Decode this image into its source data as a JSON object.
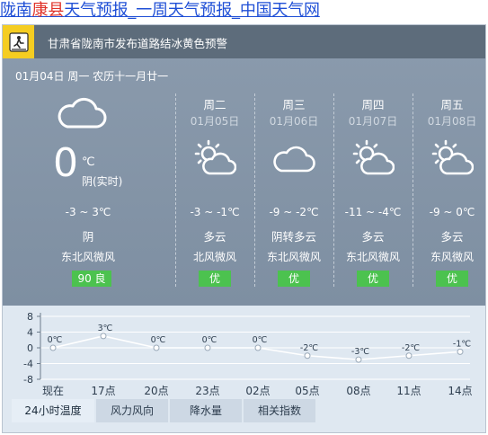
{
  "header": {
    "title_a": "陇南",
    "title_b": "康县",
    "title_c": "天气预报_一周天气预报_中国天气网"
  },
  "alert": {
    "text": "甘肃省陇南市发布道路结冰黄色预警",
    "color": "#f5cd21"
  },
  "today": {
    "date_line": "01月04日 周一 农历十一月廿一",
    "icon": "cloudy-icon",
    "temp": "0",
    "unit": "℃",
    "condition": "阴(实时)",
    "range": "-3 ~ 3℃",
    "weather": "阴",
    "wind": "东北风微风",
    "aqi": "90 良"
  },
  "days": [
    {
      "name": "周二",
      "date": "01月05日",
      "icon": "partly-cloudy-icon",
      "range": "-3 ~ -1℃",
      "weather": "多云",
      "wind": "北风微风",
      "aqi": "优"
    },
    {
      "name": "周三",
      "date": "01月06日",
      "icon": "cloudy-icon",
      "range": "-9 ~ -2℃",
      "weather": "阴转多云",
      "wind": "东北风微风",
      "aqi": "优"
    },
    {
      "name": "周四",
      "date": "01月07日",
      "icon": "partly-cloudy-icon",
      "range": "-11 ~ -4℃",
      "weather": "多云",
      "wind": "东北风微风",
      "aqi": "优"
    },
    {
      "name": "周五",
      "date": "01月08日",
      "icon": "partly-cloudy-icon",
      "range": "-9 ~ 0℃",
      "weather": "多云",
      "wind": "东风微风",
      "aqi": "优"
    }
  ],
  "chart_data": {
    "type": "line",
    "categories": [
      "现在",
      "17点",
      "20点",
      "23点",
      "02点",
      "05点",
      "08点",
      "11点",
      "14点"
    ],
    "series": [
      {
        "values": [
          0,
          3,
          0,
          0,
          0,
          -2,
          -3,
          -2,
          -1
        ]
      }
    ],
    "point_labels": [
      "0℃",
      "3℃",
      "0℃",
      "0℃",
      "0℃",
      "-2℃",
      "-3℃",
      "-2℃",
      "-1℃"
    ],
    "y_ticks": [
      "8",
      "4",
      "0",
      "-4",
      "-8"
    ],
    "ylim": [
      -8,
      8
    ],
    "grid": true
  },
  "tabs": [
    {
      "label": "24小时温度",
      "active": true
    },
    {
      "label": "风力风向",
      "active": false
    },
    {
      "label": "降水量",
      "active": false
    },
    {
      "label": "相关指数",
      "active": false
    }
  ],
  "colors": {
    "aqi_good": "#4cc24f",
    "widget_bg": "#8495a7",
    "chart_bg": "#dfe8f1"
  }
}
